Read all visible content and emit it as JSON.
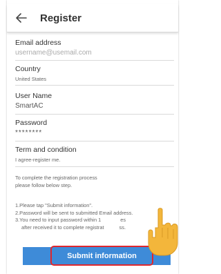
{
  "header": {
    "title": "Register",
    "back_icon": "arrow-left-icon"
  },
  "form": {
    "email": {
      "label": "Email address",
      "placeholder": "username@usemail.com"
    },
    "country": {
      "label": "Country",
      "value": "United States"
    },
    "username": {
      "label": "User Name",
      "value": "SmartAC"
    },
    "password": {
      "label": "Password",
      "value": "********"
    },
    "terms": {
      "label": "Term and condition",
      "value": "I agree-register me."
    }
  },
  "info": {
    "line1": "To complete the registration process",
    "line2": "please follow below step."
  },
  "instructions": {
    "step1": "1.Please tap \"Submit information\".",
    "step2": "2.Password will be sent to submitted Email address.",
    "step3": "3.You need to input password  within 1",
    "step3_tail": "es",
    "step4": "after received it to complete registrat",
    "step4_tail": "ss."
  },
  "submit": {
    "label": "Submit information"
  },
  "colors": {
    "button_bg": "#3e8bd8",
    "highlight_border": "#e0262c",
    "hand": "#f3b63b"
  }
}
